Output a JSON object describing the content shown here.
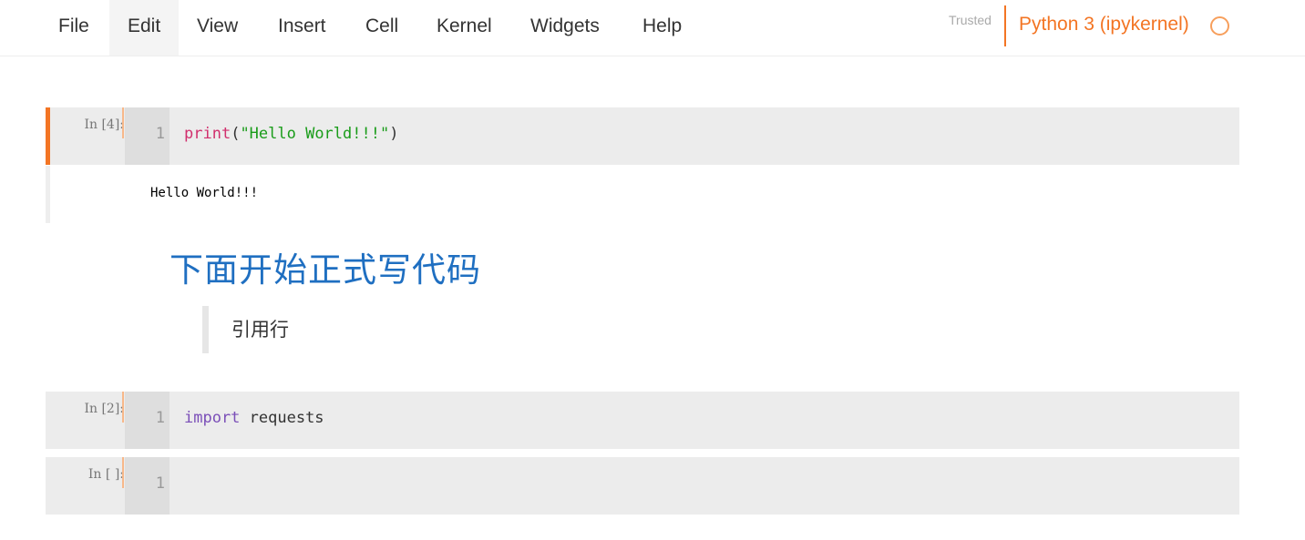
{
  "menu": {
    "items": [
      "File",
      "Edit",
      "View",
      "Insert",
      "Cell",
      "Kernel",
      "Widgets",
      "Help"
    ]
  },
  "status": {
    "trusted": "Trusted",
    "kernel_name": "Python 3 (ipykernel)",
    "kernel_state_icon": "circle-outline-idle",
    "accent_color": "#f37524"
  },
  "cells": [
    {
      "prompt": "In  [4]:",
      "line_number": "1",
      "code_fn": "print",
      "code_open": "(",
      "code_string": "\"Hello World!!!\"",
      "code_close": ")",
      "output": "Hello World!!!"
    },
    {
      "heading": "下面开始正式写代码",
      "quote": "引用行"
    },
    {
      "prompt": "In  [2]:",
      "line_number": "1",
      "code_kw": "import",
      "code_rest": " requests"
    },
    {
      "prompt": "In  [ ]:",
      "line_number": "1"
    }
  ]
}
